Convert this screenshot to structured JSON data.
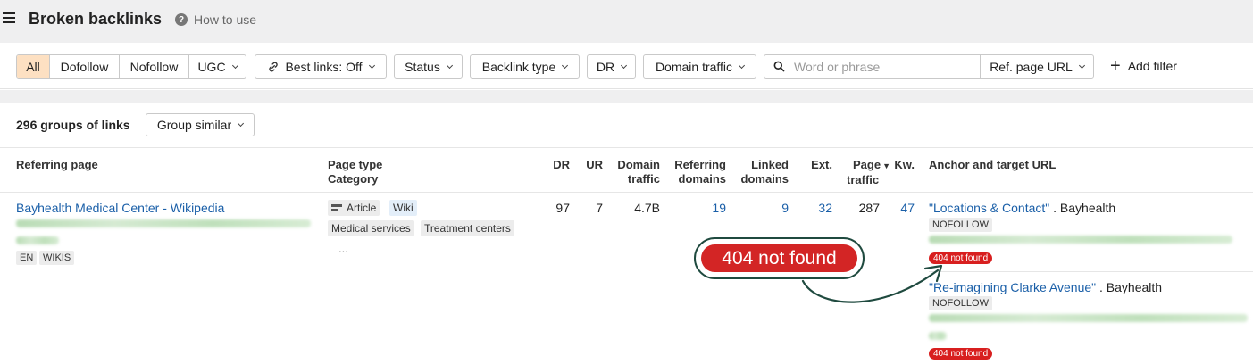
{
  "header": {
    "title": "Broken backlinks",
    "help_label": "How to use"
  },
  "filters": {
    "segments": [
      "All",
      "Dofollow",
      "Nofollow",
      "UGC"
    ],
    "best_links": "Best links: Off",
    "status": "Status",
    "backlink_type": "Backlink type",
    "dr": "DR",
    "domain_traffic": "Domain traffic",
    "search_placeholder": "Word or phrase",
    "search_value": "",
    "ref_page_url": "Ref. page URL",
    "add_filter": "Add filter"
  },
  "summary": {
    "groups_count": "296 groups of links",
    "group_similar": "Group similar"
  },
  "table": {
    "columns": {
      "referring_page": "Referring page",
      "page_type_1": "Page type",
      "page_type_2": "Category",
      "dr": "DR",
      "ur": "UR",
      "domain_traffic_1": "Domain",
      "domain_traffic_2": "traffic",
      "referring_domains_1": "Referring",
      "referring_domains_2": "domains",
      "linked_domains_1": "Linked",
      "linked_domains_2": "domains",
      "ext": "Ext.",
      "page_traffic_1": "Page",
      "page_traffic_2": "traffic",
      "kw": "Kw.",
      "anchor": "Anchor and target URL"
    },
    "rows": [
      {
        "title": "Bayhealth Medical Center - Wikipedia",
        "lang": "EN",
        "tag": "WIKIS",
        "page_types": [
          "Article",
          "Wiki"
        ],
        "categories": [
          "Medical services",
          "Treatment centers"
        ],
        "more": "...",
        "dr": "97",
        "ur": "7",
        "domain_traffic": "4.7B",
        "referring_domains": "19",
        "linked_domains": "9",
        "ext": "32",
        "page_traffic": "287",
        "kw": "47",
        "anchors": [
          {
            "text": "\"Locations & Contact\"",
            "site": ". Bayhealth",
            "rel": "NOFOLLOW",
            "status": "404 not found"
          },
          {
            "text": "\"Re-imagining Clarke Avenue\"",
            "site": ". Bayhealth",
            "rel": "NOFOLLOW",
            "status": "404 not found"
          }
        ]
      }
    ]
  },
  "callout": {
    "label": "404 not found"
  },
  "colors": {
    "accent_orange": "#fde0c2",
    "link_blue": "#1a5fa8",
    "error_red": "#d32525",
    "callout_border": "#1f4a3f"
  }
}
